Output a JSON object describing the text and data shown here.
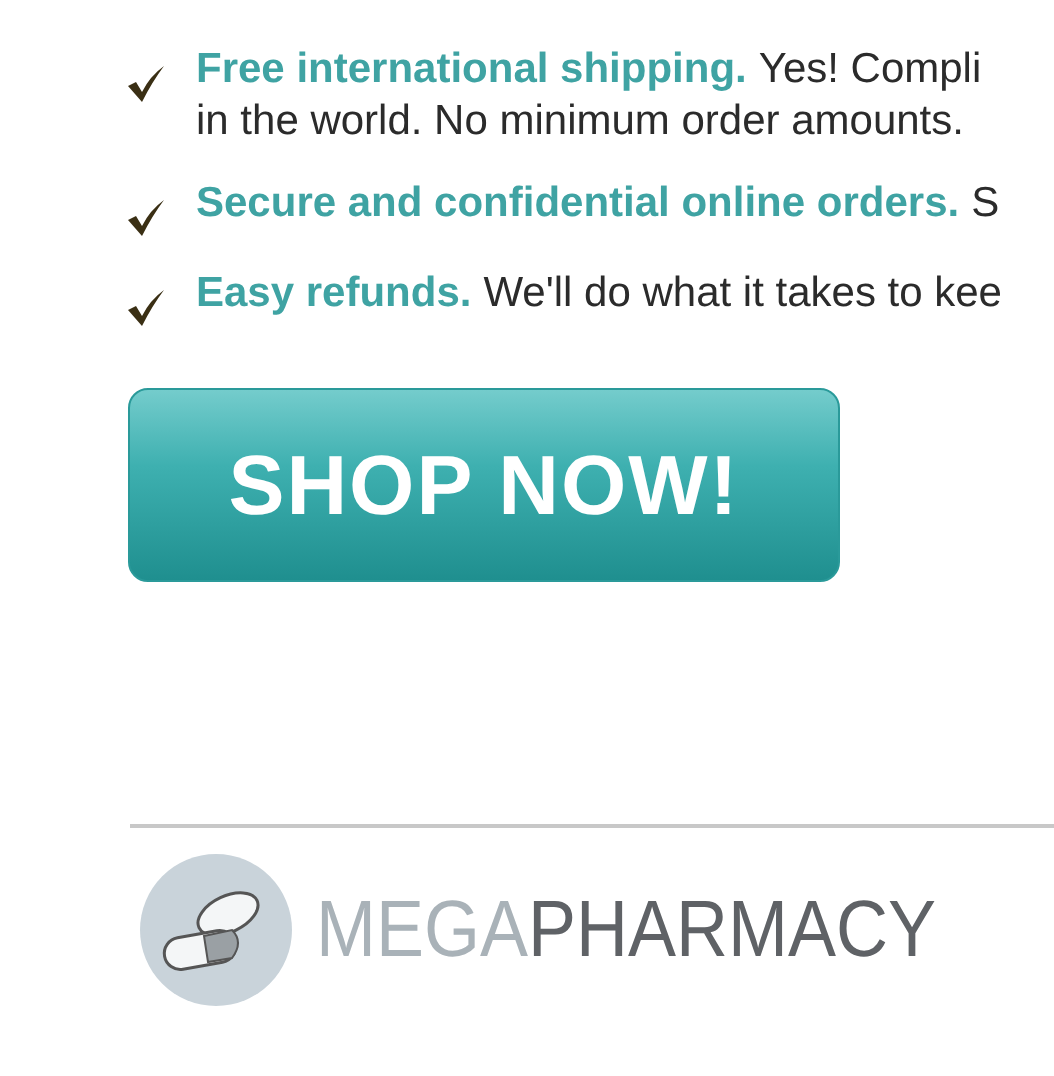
{
  "benefits": [
    {
      "title": "Free international shipping.",
      "lines": [
        "Yes! Compli",
        "in the world. No minimum order amounts."
      ]
    },
    {
      "title": "Secure and confidential online orders.",
      "lines": [
        "S"
      ]
    },
    {
      "title": "Easy refunds.",
      "lines": [
        "We'll do what it takes to kee"
      ]
    }
  ],
  "button": {
    "label": "SHOP NOW!"
  },
  "logo": {
    "light": "MEGA",
    "dark": "PHARMACY"
  }
}
